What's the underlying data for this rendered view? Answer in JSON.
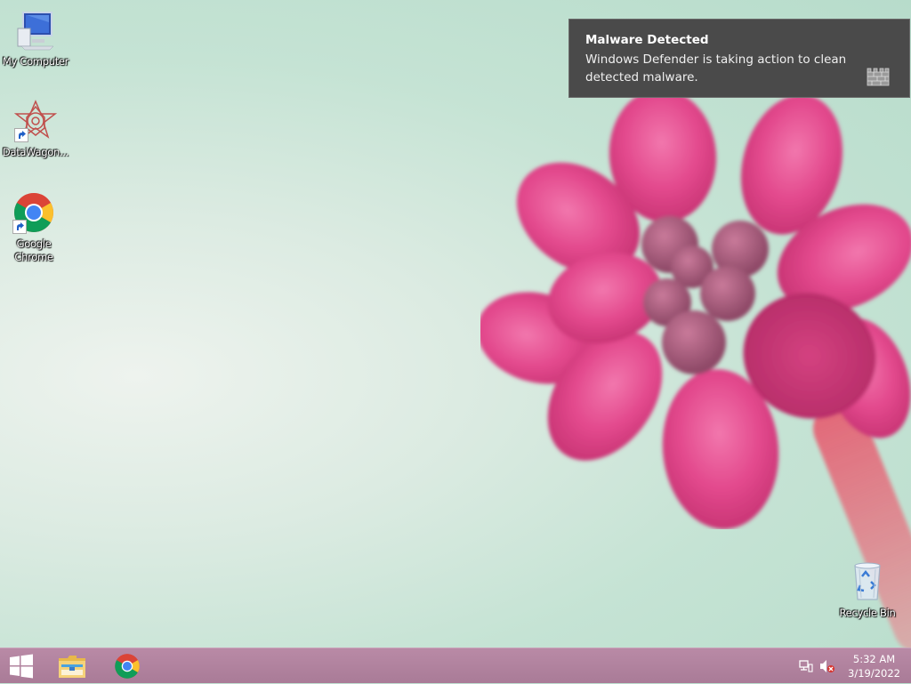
{
  "desktop": {
    "icons": [
      {
        "label": "My Computer"
      },
      {
        "label": "DataWagon..."
      },
      {
        "label": "Google Chrome"
      },
      {
        "label": "Recycle Bin"
      }
    ]
  },
  "notification": {
    "title": "Malware Detected",
    "body": "Windows Defender is taking action to clean detected malware.",
    "icon": "defender-castle-icon"
  },
  "taskbar": {
    "start_icon": "windows-start-icon",
    "pinned": [
      {
        "icon": "file-explorer-icon"
      },
      {
        "icon": "chrome-icon"
      }
    ],
    "tray": {
      "network_icon": "network-icon",
      "volume_icon": "volume-muted-icon"
    },
    "clock": {
      "time": "5:32 AM",
      "date": "3/19/2022"
    }
  },
  "colors": {
    "taskbar": "#b08399",
    "toast_bg": "#4a4a4a",
    "flower": "#e04a8a"
  }
}
